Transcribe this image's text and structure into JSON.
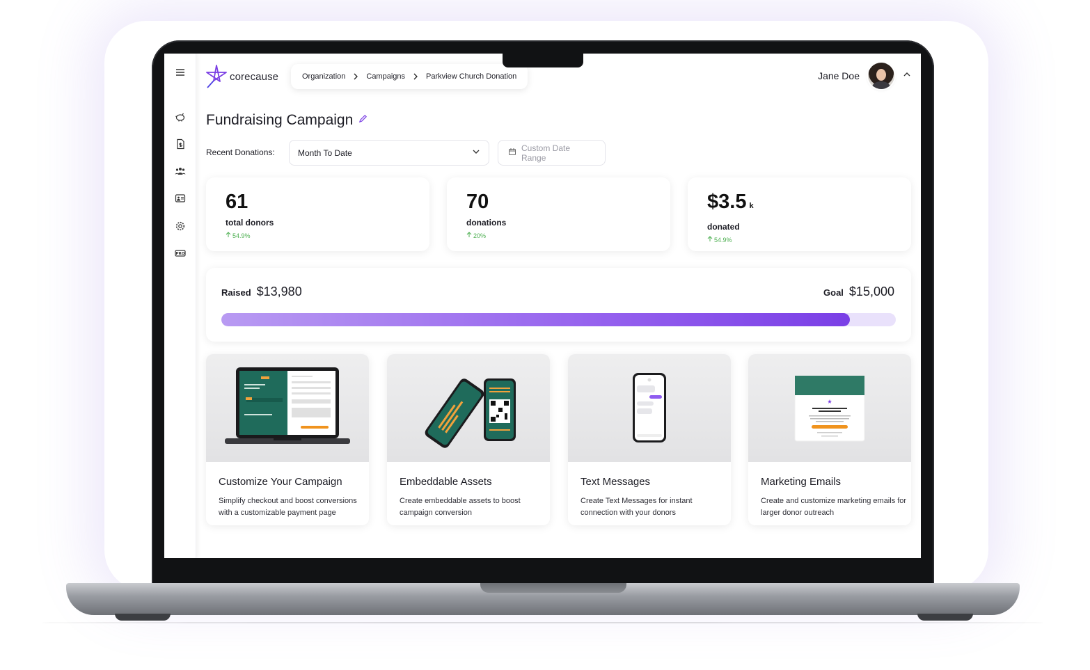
{
  "brand": {
    "name": "corecause",
    "accent": "#7b3fe4"
  },
  "breadcrumb": [
    "Organization",
    "Campaigns",
    "Parkview Church Donation"
  ],
  "user": {
    "name": "Jane Doe"
  },
  "sidebar": {
    "icons": [
      "menu-icon",
      "piggy-bank-icon",
      "document-dollar-icon",
      "people-icon",
      "id-card-icon",
      "gear-icon",
      "pro-badge-icon"
    ]
  },
  "page": {
    "title": "Fundraising Campaign"
  },
  "filters": {
    "label": "Recent Donations:",
    "period": "Month To Date",
    "date_range": "Custom Date Range"
  },
  "stats": [
    {
      "value": "61",
      "unit": "",
      "label": "total donors",
      "change": "54.9%"
    },
    {
      "value": "70",
      "unit": "",
      "label": "donations",
      "change": "20%"
    },
    {
      "value": "$3.5",
      "unit": "k",
      "label": "donated",
      "change": "54.9%"
    }
  ],
  "progress": {
    "raised_label": "Raised",
    "raised_amount": "$13,980",
    "goal_label": "Goal",
    "goal_amount": "$15,000",
    "fraction": 0.932
  },
  "features": [
    {
      "title": "Customize Your Campaign",
      "description": "Simplify checkout and boost conversions with a customizable payment page",
      "image": "laptop-mockup"
    },
    {
      "title": "Embeddable Assets",
      "description": "Create embeddable assets to boost campaign conversion",
      "image": "phones-mockup"
    },
    {
      "title": "Text Messages",
      "description": "Create Text Messages for instant connection with your donors",
      "image": "phone-sms-mockup"
    },
    {
      "title": "Marketing Emails",
      "description": "Create and customize marketing emails for larger donor outreach",
      "image": "email-mockup"
    }
  ]
}
